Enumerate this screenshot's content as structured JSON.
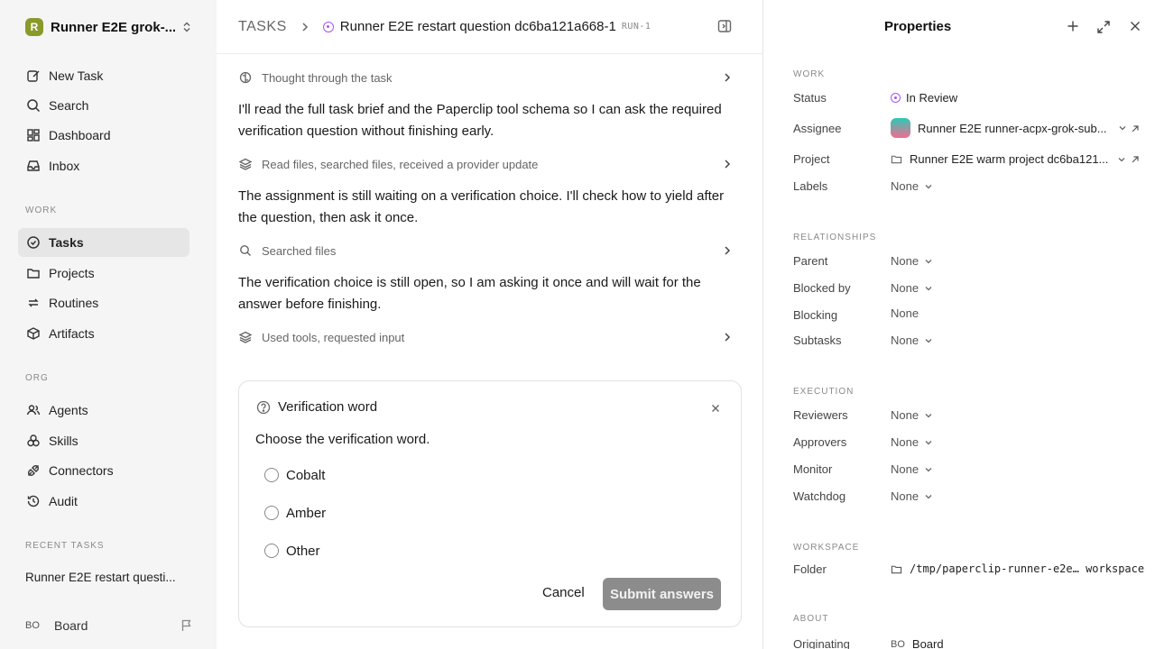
{
  "sidebar": {
    "workspace_logo": "R",
    "workspace_name": "Runner E2E grok-...",
    "nav_top": [
      {
        "label": "New Task",
        "icon": "edit-icon"
      },
      {
        "label": "Search",
        "icon": "search-icon"
      },
      {
        "label": "Dashboard",
        "icon": "dashboard-icon"
      },
      {
        "label": "Inbox",
        "icon": "inbox-icon"
      }
    ],
    "section_work": "WORK",
    "nav_work": [
      {
        "label": "Tasks",
        "icon": "check-circle-icon",
        "active": true
      },
      {
        "label": "Projects",
        "icon": "folder-icon"
      },
      {
        "label": "Routines",
        "icon": "repeat-icon"
      },
      {
        "label": "Artifacts",
        "icon": "box-icon"
      }
    ],
    "section_org": "ORG",
    "nav_org": [
      {
        "label": "Agents",
        "icon": "users-icon"
      },
      {
        "label": "Skills",
        "icon": "skills-icon"
      },
      {
        "label": "Connectors",
        "icon": "plug-icon"
      },
      {
        "label": "Audit",
        "icon": "history-icon"
      }
    ],
    "section_recent": "RECENT TASKS",
    "recent_task": "Runner E2E restart questi...",
    "board_initials": "BO",
    "board_label": "Board"
  },
  "header": {
    "root": "TASKS",
    "title": "Runner E2E restart question dc6ba121a668-1",
    "run": "RUN-1"
  },
  "activity": {
    "thought": "Thought through the task",
    "para1": "I'll read the full task brief and the Paperclip tool schema so I can ask the required verification question without finishing early.",
    "step1": "Read files, searched files, received a provider update",
    "para2": "The assignment is still waiting on a verification choice. I'll check how to yield after the question, then ask it once.",
    "step2": "Searched files",
    "para3": "The verification choice is still open, so I am asking it once and will wait for the answer before finishing.",
    "step3": "Used tools, requested input"
  },
  "question": {
    "title": "Verification word",
    "prompt": "Choose the verification word.",
    "options": [
      "Cobalt",
      "Amber",
      "Other"
    ],
    "cancel": "Cancel",
    "submit": "Submit answers"
  },
  "properties": {
    "title": "Properties",
    "work_section": "WORK",
    "status_label": "Status",
    "status_value": "In Review",
    "assignee_label": "Assignee",
    "assignee_value": "Runner E2E runner-acpx-grok-sub...",
    "project_label": "Project",
    "project_value": "Runner E2E warm project dc6ba121...",
    "labels_label": "Labels",
    "labels_value": "None",
    "relationships_section": "RELATIONSHIPS",
    "parent_label": "Parent",
    "parent_value": "None",
    "blocked_by_label": "Blocked by",
    "blocked_by_value": "None",
    "blocking_label": "Blocking",
    "blocking_value": "None",
    "subtasks_label": "Subtasks",
    "subtasks_value": "None",
    "execution_section": "EXECUTION",
    "reviewers_label": "Reviewers",
    "reviewers_value": "None",
    "approvers_label": "Approvers",
    "approvers_value": "None",
    "monitor_label": "Monitor",
    "monitor_value": "None",
    "watchdog_label": "Watchdog",
    "watchdog_value": "None",
    "workspace_section": "WORKSPACE",
    "folder_label": "Folder",
    "folder_value": "/tmp/paperclip-runner-e2e… workspace",
    "about_section": "ABOUT",
    "originating_label": "Originating",
    "originating_initials": "BO",
    "originating_value": "Board"
  },
  "colors": {
    "accent_status": "#a855f7",
    "submit_button": "#8c8c8c",
    "sidebar_bg": "#f5f5f5"
  }
}
